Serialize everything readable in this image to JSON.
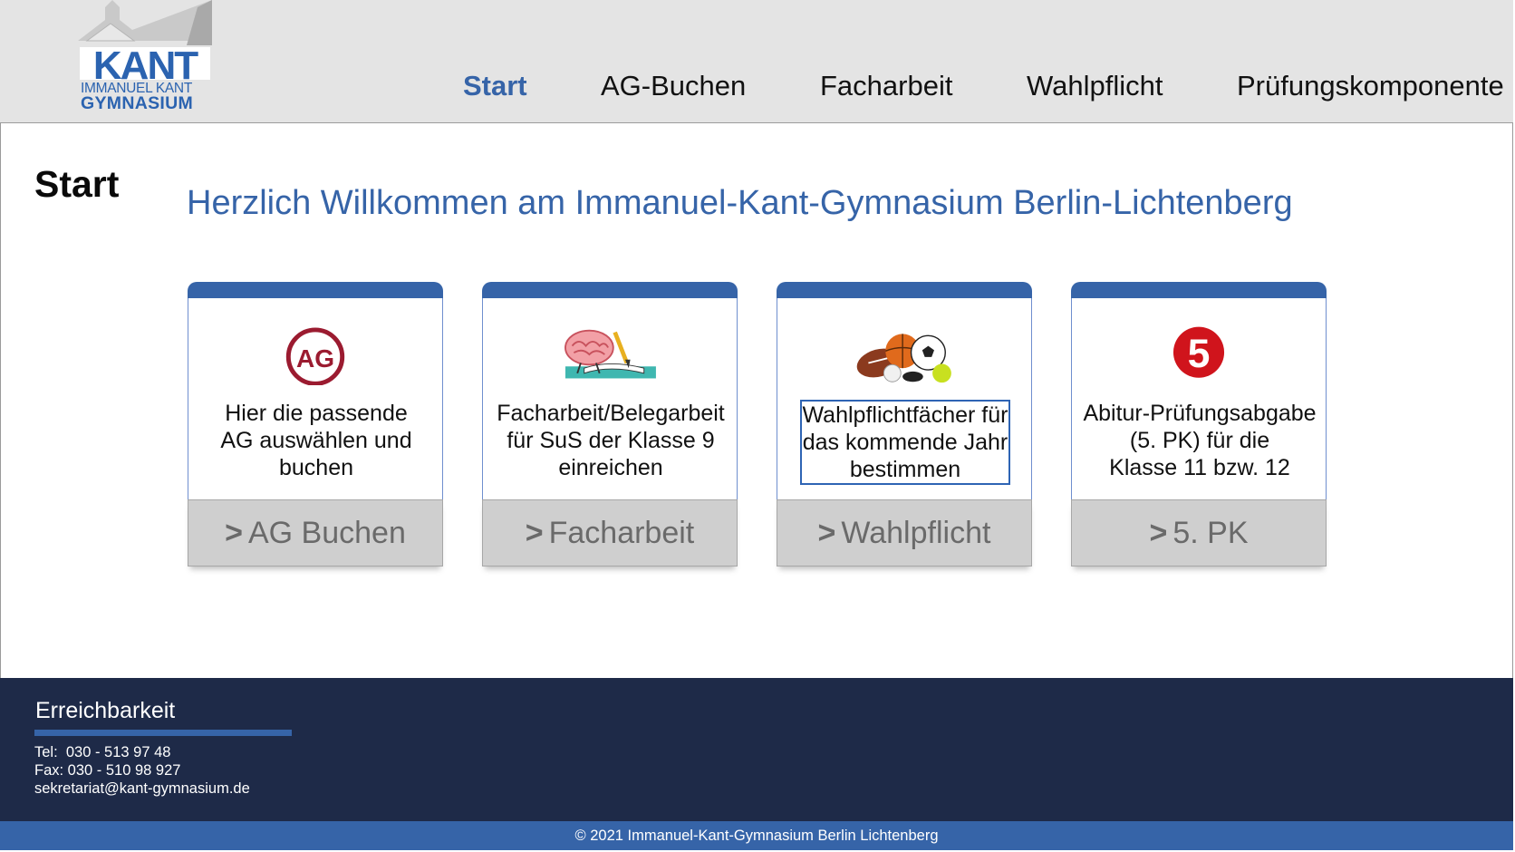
{
  "logo": {
    "word": "KANT",
    "line1": "IMMANUEL KANT",
    "line2": "GYMNASIUM"
  },
  "nav": {
    "items": [
      {
        "label": "Start",
        "active": true
      },
      {
        "label": "AG-Buchen",
        "active": false
      },
      {
        "label": "Facharbeit",
        "active": false
      },
      {
        "label": "Wahlpflicht",
        "active": false
      },
      {
        "label": "Prüfungskomponente",
        "active": false
      }
    ]
  },
  "main": {
    "title": "Start",
    "welcome": "Herzlich Willkommen am Immanuel-Kant-Gymnasium Berlin-Lichtenberg"
  },
  "cards": [
    {
      "icon": "ag-circle-icon",
      "icon_text": "AG",
      "lines": [
        "Hier die passende",
        "AG auswählen und",
        "buchen"
      ],
      "button_arrow": ">",
      "button_label": "AG Buchen"
    },
    {
      "icon": "brain-writing-icon",
      "lines": [
        "Facharbeit/Belegarbeit",
        "für SuS der Klasse 9",
        "einreichen"
      ],
      "button_arrow": ">",
      "button_label": "Facharbeit"
    },
    {
      "icon": "sports-balls-icon",
      "lines": [
        "Wahlpflichtfächer für",
        "das kommende Jahr",
        "bestimmen"
      ],
      "button_arrow": ">",
      "button_label": "Wahlpflicht"
    },
    {
      "icon": "number-five-icon",
      "icon_text": "5",
      "lines": [
        "Abitur-Prüfungsabgabe",
        "(5. PK) für die",
        "Klasse 11 bzw. 12"
      ],
      "button_arrow": ">",
      "button_label": "5. PK"
    }
  ],
  "footer": {
    "title": "Erreichbarkeit",
    "tel": "Tel:  030 - 513 97 48",
    "fax": "Fax: 030 - 510 98 927",
    "email": "sekretariat@kant-gymnasium.de",
    "copyright": "© 2021 Immanuel-Kant-Gymnasium Berlin Lichtenberg"
  },
  "colors": {
    "accent": "#3664a8",
    "header_bg": "#e4e4e4",
    "footer_bg": "#1e2a48",
    "ag_red": "#9b1b30",
    "five_red": "#d0141c"
  }
}
